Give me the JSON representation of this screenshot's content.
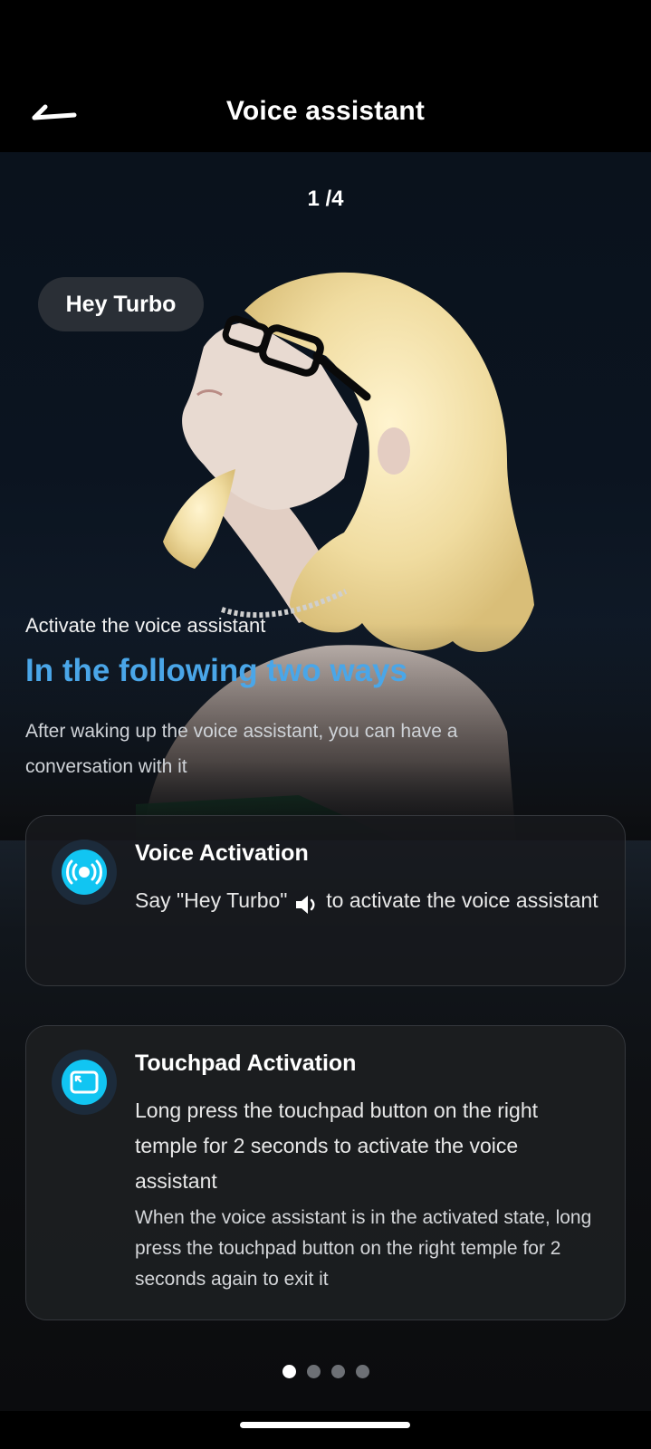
{
  "header": {
    "title": "Voice assistant",
    "back_icon": "back-arrow-icon"
  },
  "pager": {
    "counter": "1 /4",
    "total_dots": 4,
    "active_index": 0
  },
  "hero": {
    "wake_word_chip": "Hey Turbo",
    "kicker": "Activate the voice assistant",
    "title": "In the following two ways",
    "description": "After waking up the voice assistant, you can have a conversation with it"
  },
  "cards": {
    "voice": {
      "icon": "voice-wave-icon",
      "title": "Voice Activation",
      "body_before": "Say \"Hey Turbo\"",
      "inline_icon": "speaker-icon",
      "body_after": "to activate the voice assistant"
    },
    "touchpad": {
      "icon": "touchpad-icon",
      "title": "Touchpad Activation",
      "body": "Long press the touchpad button on the right temple for 2 seconds to activate the voice assistant",
      "note": "When the voice assistant is in the activated state, long press the touchpad button on the right temple for 2 seconds again to exit it"
    }
  },
  "colors": {
    "accent_title": "#4aa6e8",
    "icon_cyan": "#11c5f2",
    "card_bg": "#1c1e21",
    "background": "#000000"
  }
}
